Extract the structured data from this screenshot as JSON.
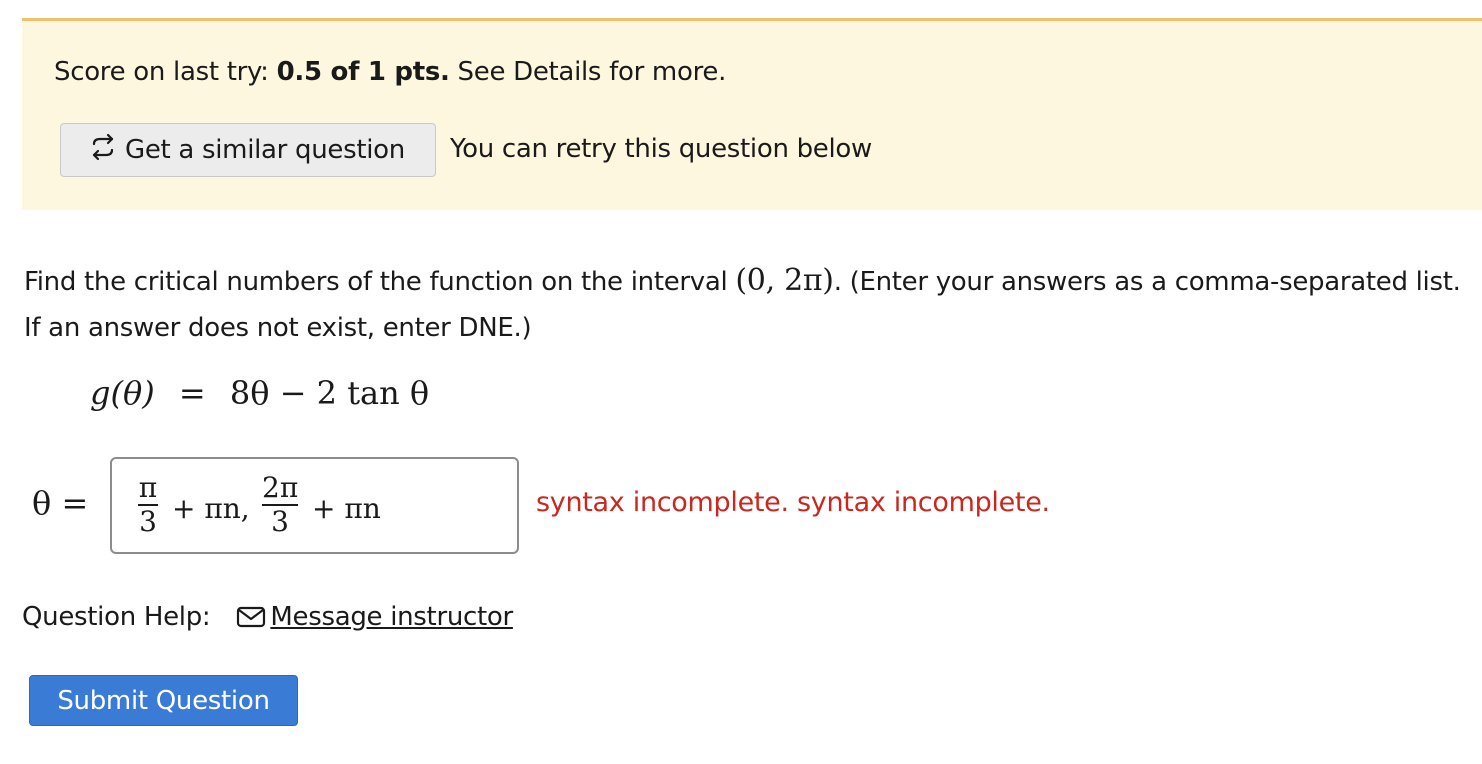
{
  "banner": {
    "score_prefix": "Score on last try: ",
    "score_value": "0.5 of 1 pts.",
    "score_suffix": " See Details for more.",
    "similar_button_label": "Get a similar question",
    "retry_text": "You can retry this question below"
  },
  "question": {
    "prompt_before": "Find the critical numbers of the function on the interval ",
    "interval": "(0, 2π)",
    "prompt_after": ". (Enter your answers as a comma-separated list. If an answer does not exist, enter DNE.)",
    "function_lhs": "g(θ)",
    "function_equals": "=",
    "function_rhs": "8θ − 2 tan θ"
  },
  "answer": {
    "variable_label": "θ =",
    "term1_num": "π",
    "term1_den": "3",
    "term1_rest": "+ πn,",
    "term2_num": "2π",
    "term2_den": "3",
    "term2_rest": "+ πn",
    "syntax_message": "syntax incomplete. syntax incomplete."
  },
  "help": {
    "label": "Question Help:",
    "message_link": "Message instructor",
    "icon": "mail-icon"
  },
  "submit_label": "Submit Question",
  "colors": {
    "banner_bg": "#fef7e0",
    "banner_border": "#f0c06a",
    "error": "#c8281e",
    "submit_bg": "#3a7bd5"
  }
}
